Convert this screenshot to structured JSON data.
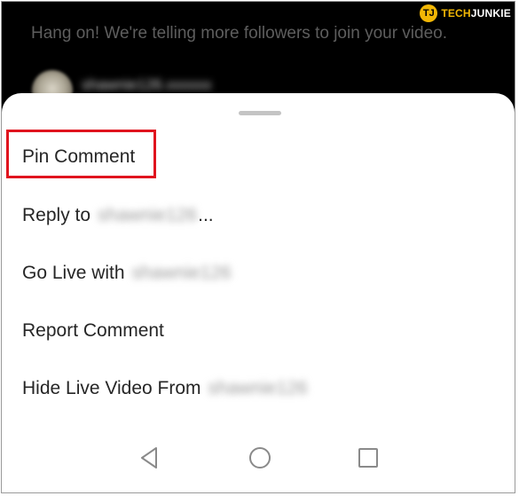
{
  "video": {
    "live_message": "Hang on! We're telling more followers to join your video.",
    "commenter_name": "shawnie126.xxxxxx"
  },
  "watermark": {
    "logo_letters": "TJ",
    "brand_part1": "TECH",
    "brand_part2": "JUNKIE"
  },
  "sheet": {
    "items": [
      {
        "label": "Pin Comment"
      },
      {
        "label": "Reply to",
        "blurred_name": "shawnie126",
        "suffix": "..."
      },
      {
        "label": "Go Live with",
        "blurred_name": "shawnie126"
      },
      {
        "label": "Report Comment"
      },
      {
        "label": "Hide Live Video From",
        "blurred_name": "shawnie126"
      }
    ]
  },
  "nav": {
    "back": "back-icon",
    "home": "home-icon",
    "recent": "recent-apps-icon"
  },
  "colors": {
    "highlight": "#e0141e",
    "brand": "#f2b705",
    "video_bg": "#000000"
  }
}
